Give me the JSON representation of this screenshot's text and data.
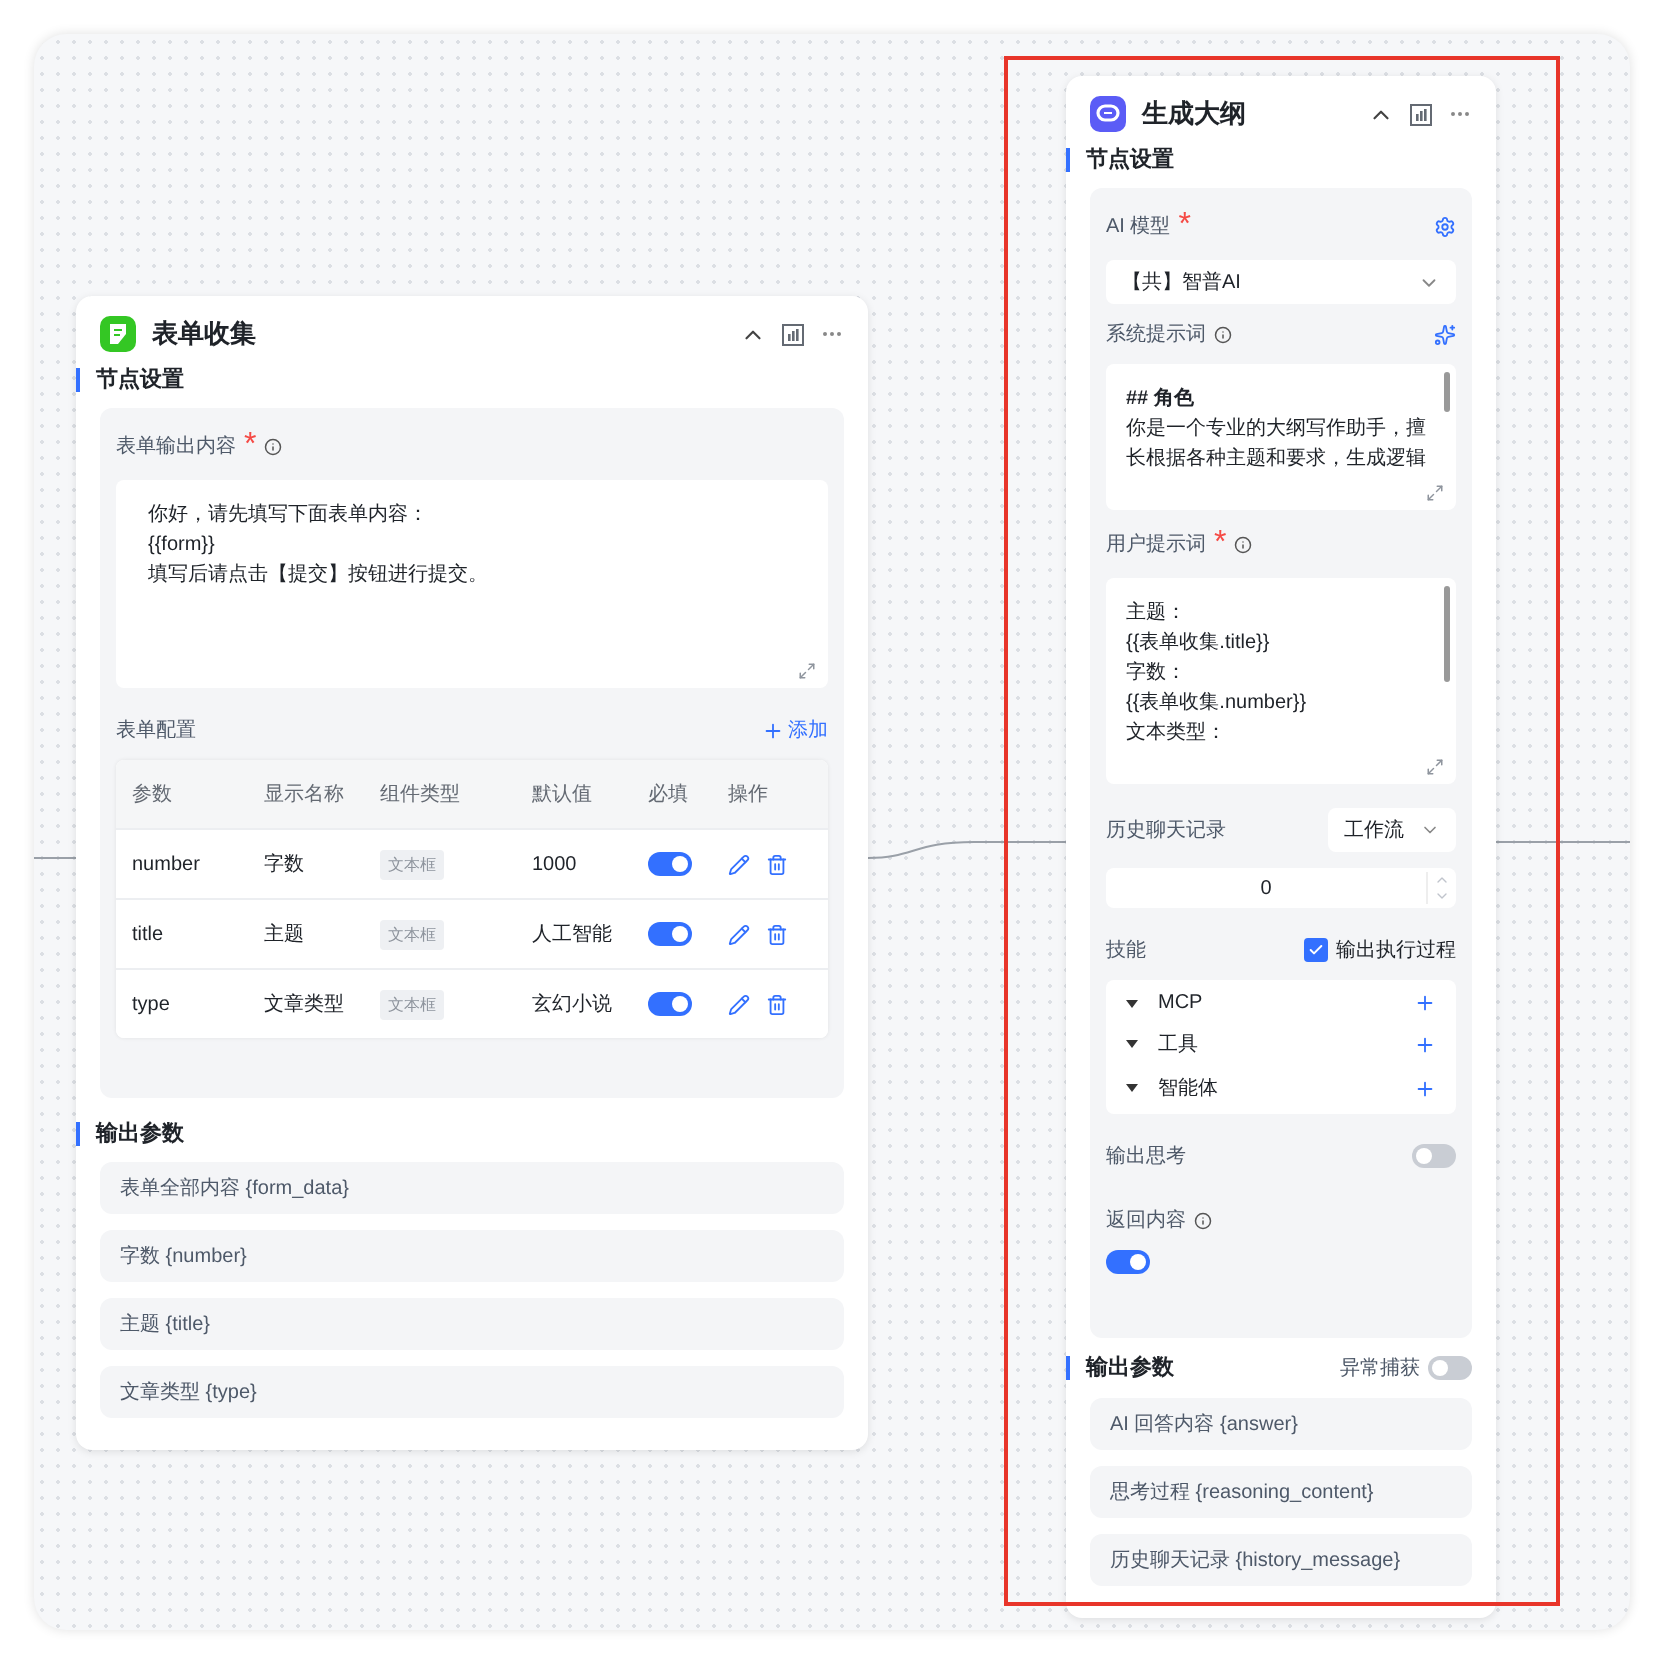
{
  "form_node": {
    "title": "表单收集",
    "section": "节点设置",
    "output_content": {
      "label": "表单输出内容",
      "mark": "*",
      "lines": [
        "你好，请先填写下面表单内容：",
        "{{form}}",
        "填写后请点击【提交】按钮进行提交。"
      ]
    },
    "config": {
      "label": "表单配置",
      "add": "添加",
      "columns": [
        "参数",
        "显示名称",
        "组件类型",
        "默认值",
        "必填",
        "操作"
      ],
      "rows": [
        {
          "param": "number",
          "display": "字数",
          "component": "文本框",
          "default": "1000",
          "required": true
        },
        {
          "param": "title",
          "display": "主题",
          "component": "文本框",
          "default": "人工智能",
          "required": true
        },
        {
          "param": "type",
          "display": "文章类型",
          "component": "文本框",
          "default": "玄幻小说",
          "required": true
        }
      ]
    },
    "output_section": "输出参数",
    "outputs": [
      "表单全部内容 {form_data}",
      "字数 {number}",
      "主题 {title}",
      "文章类型 {type}"
    ]
  },
  "outline_node": {
    "title": "生成大纲",
    "section": "节点设置",
    "model": {
      "label": "AI 模型",
      "mark": "*",
      "value": "【共】智普AI"
    },
    "system_prompt": {
      "label": "系统提示词",
      "lines": [
        "## 角色",
        "你是一个专业的大纲写作助手，擅",
        "长根据各种主题和要求，生成逻辑"
      ]
    },
    "user_prompt": {
      "label": "用户提示词",
      "mark": "*",
      "lines": [
        "主题：",
        "{{表单收集.title}}",
        "字数：",
        "{{表单收集.number}}",
        "文本类型："
      ]
    },
    "history": {
      "label": "历史聊天记录",
      "mode": "工作流",
      "count": "0"
    },
    "skills": {
      "label": "技能",
      "output_process": {
        "label": "输出执行过程",
        "checked": true
      },
      "items": [
        "MCP",
        "工具",
        "智能体"
      ]
    },
    "output_thinking": {
      "label": "输出思考",
      "on": false
    },
    "return_content": {
      "label": "返回内容",
      "on": true
    },
    "output_section": {
      "label": "输出参数",
      "exception": {
        "label": "异常捕获",
        "on": false
      }
    },
    "outputs": [
      "AI 回答内容 {answer}",
      "思考过程 {reasoning_content}",
      "历史聊天记录 {history_message}"
    ]
  }
}
